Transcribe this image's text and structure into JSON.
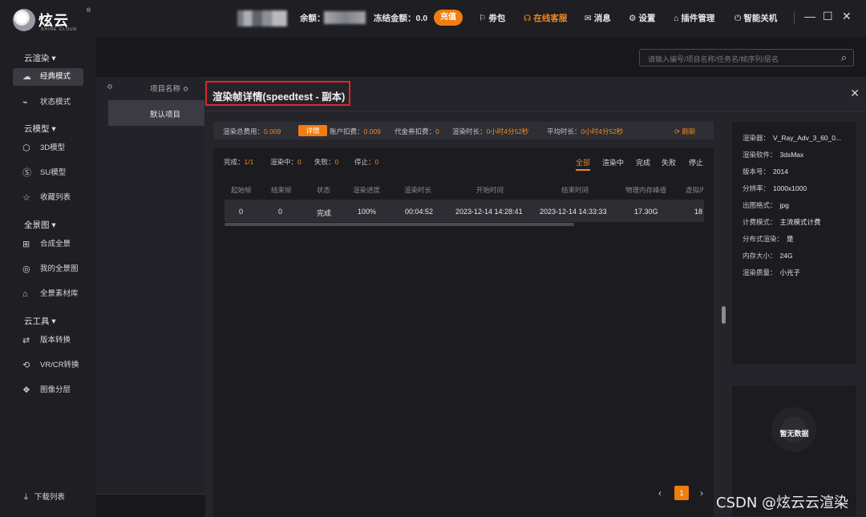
{
  "app": {
    "logo_text": "炫云",
    "logo_sub": "SHINE CLOUD",
    "logo_reg": "®"
  },
  "topbar": {
    "balance_label": "余额：",
    "frozen_label": "冻结金额：0.0",
    "recharge": "充值",
    "items": [
      {
        "icon": "gift-icon",
        "glyph": "⚐",
        "label": "劵包",
        "highlight": false
      },
      {
        "icon": "headset-icon",
        "glyph": "☊",
        "label": "在线客服",
        "highlight": true
      },
      {
        "icon": "mail-icon",
        "glyph": "✉",
        "label": "消息",
        "highlight": false
      },
      {
        "icon": "gear-icon",
        "glyph": "⚙",
        "label": "设置",
        "highlight": false
      },
      {
        "icon": "plugin-icon",
        "glyph": "⌂",
        "label": "插件管理",
        "highlight": false
      },
      {
        "icon": "power-icon",
        "glyph": "⏻",
        "label": "智能关机",
        "highlight": false
      }
    ],
    "window": {
      "minimize": "—",
      "maximize": "☐",
      "close": "✕"
    },
    "accent_color": "#f07d0f"
  },
  "sidebar": {
    "sections": [
      {
        "title": "云渲染 ▾",
        "items": [
          {
            "icon": "cloud-icon",
            "glyph": "☁",
            "label": "经典模式",
            "active": true
          },
          {
            "icon": "wave-icon",
            "glyph": "⌁",
            "label": "状态模式",
            "active": false
          }
        ]
      },
      {
        "title": "云模型 ▾",
        "items": [
          {
            "icon": "cube-icon",
            "glyph": "⬡",
            "label": "3D模型",
            "active": false
          },
          {
            "icon": "su-icon",
            "glyph": "Ⓢ",
            "label": "SU模型",
            "active": false
          },
          {
            "icon": "favorite-icon",
            "glyph": "☆",
            "label": "收藏列表",
            "active": false
          }
        ]
      },
      {
        "title": "全景图 ▾",
        "items": [
          {
            "icon": "panorama-icon",
            "glyph": "⊞",
            "label": "合成全景",
            "active": false
          },
          {
            "icon": "planet-icon",
            "glyph": "◎",
            "label": "我的全景图",
            "active": false
          },
          {
            "icon": "library-icon",
            "glyph": "⌂",
            "label": "全景素材库",
            "active": false
          }
        ]
      },
      {
        "title": "云工具 ▾",
        "items": [
          {
            "icon": "convert-icon",
            "glyph": "⇄",
            "label": "版本转换",
            "active": false
          },
          {
            "icon": "vr-icon",
            "glyph": "⟲",
            "label": "VR/CR转换",
            "active": false
          },
          {
            "icon": "layers-icon",
            "glyph": "❖",
            "label": "图像分层",
            "active": false
          }
        ]
      }
    ],
    "download": "下载列表"
  },
  "main": {
    "search_placeholder": "请输入编号/项目名称/任务名/帧序列/层名",
    "project_col": "项目名称 ≎",
    "sort_icon": "≎",
    "project_row": "默认项目"
  },
  "modal": {
    "title": "渲染帧详情(speedtest - 副本)",
    "close": "✕",
    "cost": {
      "total_label": "渲染总费用：",
      "total": "0.009",
      "detail_btn": "详情",
      "account_label": "账户扣费：",
      "account": "0.009",
      "voucher_label": "代金券扣费：",
      "voucher": "0",
      "render_time_label": "渲染时长：",
      "render_time": "0小时4分52秒",
      "avg_time_label": "平均时长：",
      "avg_time": "0小时4分52秒",
      "refresh": "⟳ 刷新"
    },
    "stats": [
      {
        "label": "完成：",
        "value": "1/1"
      },
      {
        "label": "渲染中：",
        "value": "0"
      },
      {
        "label": "失败：",
        "value": "0"
      },
      {
        "label": "停止：",
        "value": "0"
      }
    ],
    "filters": [
      {
        "label": "全部",
        "active": true
      },
      {
        "label": "渲染中",
        "active": false
      },
      {
        "label": "完成",
        "active": false
      },
      {
        "label": "失败",
        "active": false
      },
      {
        "label": "停止",
        "active": false
      }
    ],
    "table": {
      "columns": [
        "起始帧",
        "结束帧",
        "状态",
        "渲染进度",
        "渲染时长",
        "开始时间",
        "结束时间",
        "物理内存峰值",
        "虚拟内"
      ],
      "rows": [
        [
          "0",
          "0",
          "完成",
          "100%",
          "00:04:52",
          "2023-12-14 14:28:41",
          "2023-12-14 14:33:33",
          "17.30G",
          "18"
        ]
      ]
    },
    "pager": {
      "prev": "‹",
      "current": "1",
      "next": "›"
    },
    "info": [
      {
        "label": "渲染器：",
        "value": "V_Ray_Adv_3_60_0..."
      },
      {
        "label": "渲染软件：",
        "value": "3dsMax"
      },
      {
        "label": "版本号：",
        "value": "2014"
      },
      {
        "label": "分辨率：",
        "value": "1000x1000"
      },
      {
        "label": "出图格式：",
        "value": "jpg"
      },
      {
        "label": "计费模式：",
        "value": "主流模式计费"
      },
      {
        "label": "分布式渲染：",
        "value": "是"
      },
      {
        "label": "内存大小：",
        "value": "24G"
      },
      {
        "label": "渲染质量：",
        "value": "小光子"
      }
    ],
    "empty": "暂无数据"
  },
  "watermark": "CSDN @炫云云渲染"
}
